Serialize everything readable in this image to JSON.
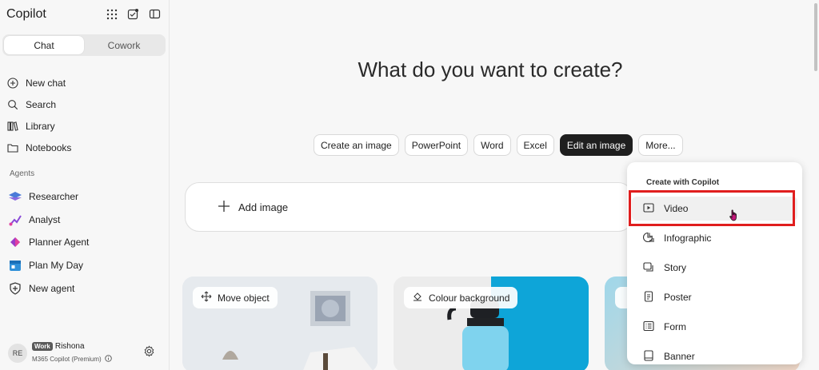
{
  "app": {
    "title": "Copilot"
  },
  "toggle": {
    "chat": "Chat",
    "cowork": "Cowork"
  },
  "nav": [
    {
      "label": "New chat",
      "icon": "plus-circle-icon"
    },
    {
      "label": "Search",
      "icon": "search-icon"
    },
    {
      "label": "Library",
      "icon": "library-icon"
    },
    {
      "label": "Notebooks",
      "icon": "folder-icon"
    }
  ],
  "agents_label": "Agents",
  "agents": [
    {
      "label": "Researcher",
      "icon": "researcher-icon"
    },
    {
      "label": "Analyst",
      "icon": "analyst-icon"
    },
    {
      "label": "Planner Agent",
      "icon": "planner-icon"
    },
    {
      "label": "Plan My Day",
      "icon": "calendar-icon"
    },
    {
      "label": "New agent",
      "icon": "new-agent-icon"
    }
  ],
  "user": {
    "initials": "RE",
    "badge": "Work",
    "name": "Rishona",
    "plan": "M365 Copilot (Premium)"
  },
  "main": {
    "headline": "What do you want to create?",
    "chips": [
      "Create an image",
      "PowerPoint",
      "Word",
      "Excel",
      "Edit an image",
      "More..."
    ],
    "active_chip": "Edit an image",
    "upload_label": "Add image",
    "cards": [
      {
        "label": "Move object"
      },
      {
        "label": "Colour background"
      }
    ]
  },
  "menu": {
    "title": "Create with Copilot",
    "items": [
      {
        "label": "Video",
        "icon": "video-icon"
      },
      {
        "label": "Infographic",
        "icon": "infographic-icon"
      },
      {
        "label": "Story",
        "icon": "story-icon"
      },
      {
        "label": "Poster",
        "icon": "poster-icon"
      },
      {
        "label": "Form",
        "icon": "form-icon"
      },
      {
        "label": "Banner",
        "icon": "banner-icon"
      }
    ]
  },
  "colors": {
    "highlight": "#e01e1e",
    "accent_dark": "#1f1f1f",
    "card_blue": "#0ea5d8"
  }
}
